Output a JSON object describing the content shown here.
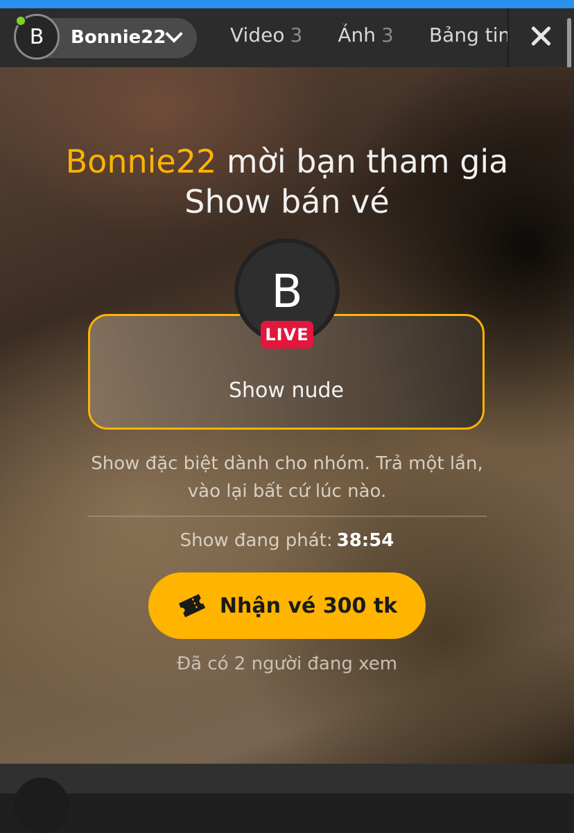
{
  "header": {
    "model": {
      "avatar_letter": "B",
      "name": "Bonnie22",
      "online": true
    },
    "tabs": [
      {
        "label": "Video",
        "count": "3"
      },
      {
        "label": "Ảnh",
        "count": "3"
      },
      {
        "label": "Bảng tin",
        "count": ""
      }
    ]
  },
  "invite": {
    "model_name": "Bonnie22",
    "title_rest": " mời bạn tham gia",
    "title_line2": "Show bán vé"
  },
  "show": {
    "avatar_letter": "B",
    "live_badge": "LIVE",
    "name": "Show nude",
    "description": "Show đặc biệt dành cho nhóm. Trả một lần, vào lại bất cứ lúc nào.",
    "timer_label": "Show đang phát:",
    "timer_value": "38:54",
    "button_label": "Nhận vé 300 tk",
    "viewers_text": "Đã có 2 người đang xem"
  },
  "colors": {
    "accent": "#ffb400",
    "live": "#e3173d",
    "online": "#7ed321",
    "top_bar": "#2b8ff0"
  },
  "icons": [
    "chevron-down-icon",
    "close-icon",
    "ticket-icon"
  ]
}
